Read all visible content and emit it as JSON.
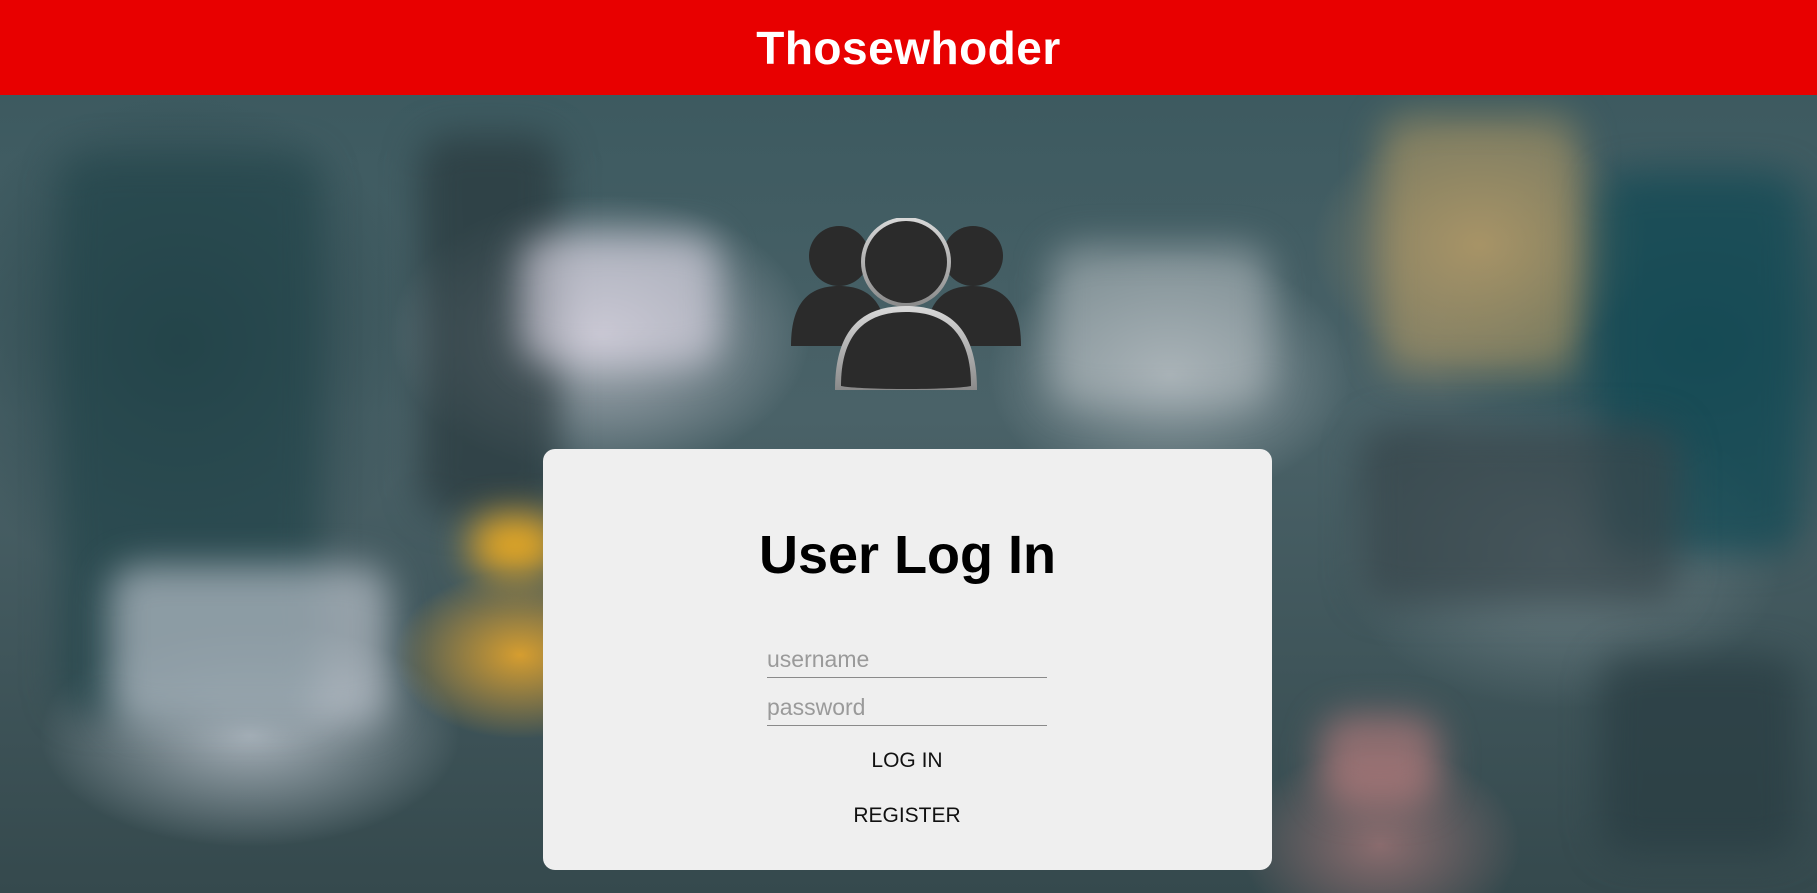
{
  "header": {
    "title": "Thosewhoder",
    "color": "#e80000"
  },
  "hero": {
    "icon": "users-group-icon"
  },
  "login_card": {
    "title": "User Log In",
    "username_placeholder": "username",
    "username_value": "",
    "password_placeholder": "password",
    "password_value": "",
    "login_label": "LOG IN",
    "register_label": "REGISTER"
  }
}
